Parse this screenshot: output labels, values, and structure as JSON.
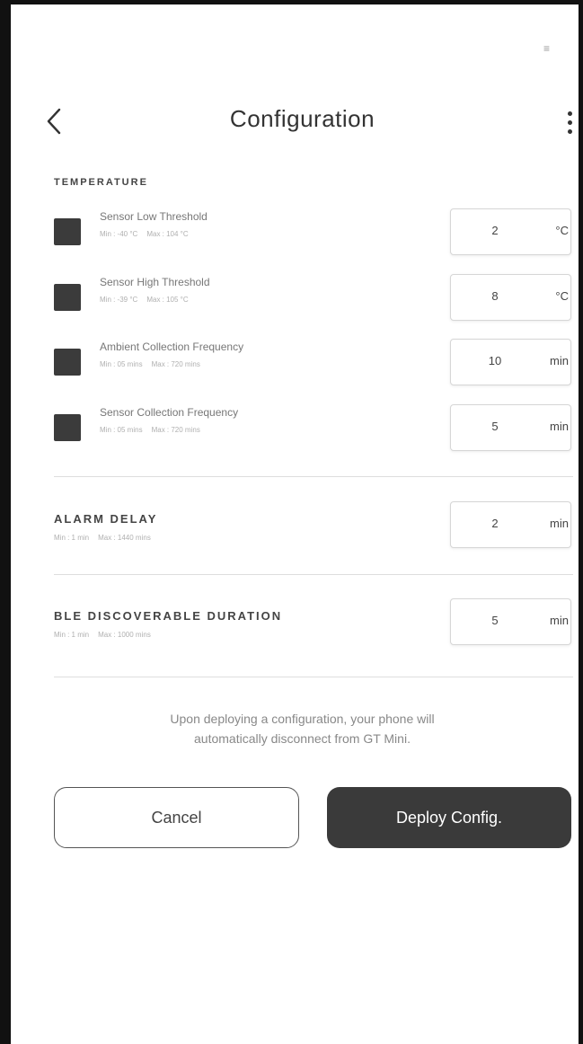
{
  "status_bar": {
    "indicator": "≡"
  },
  "header": {
    "title": "Configuration",
    "back_icon": "chevron-left-icon",
    "menu_icon": "more-vertical-icon"
  },
  "temperature": {
    "heading": "TEMPERATURE",
    "rows": [
      {
        "label": "Sensor Low Threshold",
        "min": "Min : -40 °C",
        "max": "Max : 104 °C",
        "value": "2",
        "unit": "°C"
      },
      {
        "label": "Sensor High Threshold",
        "min": "Min : -39 °C",
        "max": "Max : 105 °C",
        "value": "8",
        "unit": "°C"
      },
      {
        "label": "Ambient Collection Frequency",
        "min": "Min : 05 mins",
        "max": "Max : 720 mins",
        "value": "10",
        "unit": "min"
      },
      {
        "label": "Sensor Collection Frequency",
        "min": "Min : 05 mins",
        "max": "Max : 720 mins",
        "value": "5",
        "unit": "min"
      }
    ]
  },
  "alarm_delay": {
    "heading": "ALARM DELAY",
    "min": "Min : 1 min",
    "max": "Max : 1440 mins",
    "value": "2",
    "unit": "min"
  },
  "ble_discoverable": {
    "heading": "BLE DISCOVERABLE DURATION",
    "min": "Min : 1 min",
    "max": "Max : 1000 mins",
    "value": "5",
    "unit": "min"
  },
  "notice": {
    "line1": "Upon deploying a configuration, your phone will",
    "line2": "automatically disconnect from GT Mini."
  },
  "actions": {
    "cancel_label": "Cancel",
    "deploy_label": "Deploy Config."
  },
  "colors": {
    "dark": "#3a3a3a",
    "text": "#333333",
    "muted": "#888888",
    "border": "#d6d6d6"
  }
}
